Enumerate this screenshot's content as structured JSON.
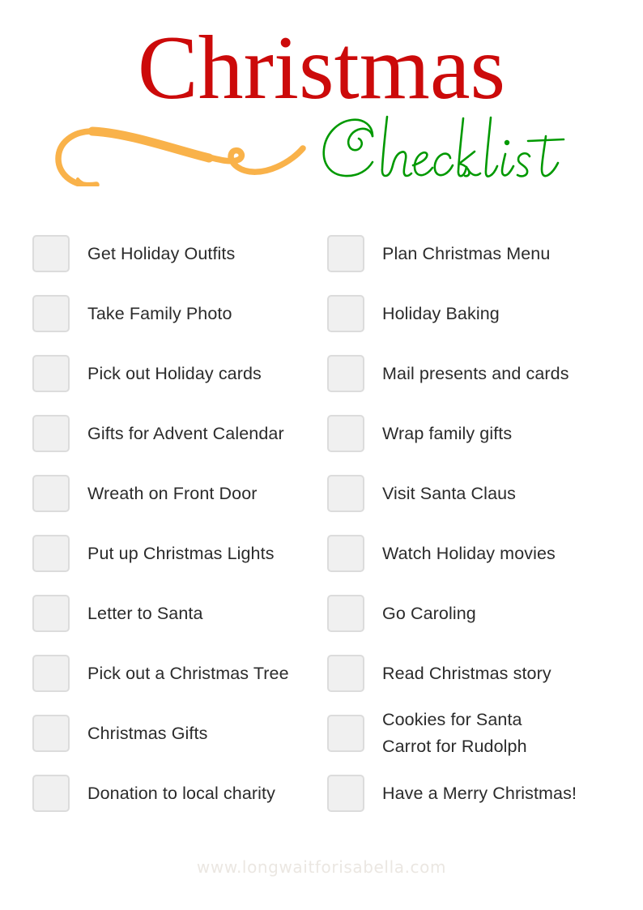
{
  "header": {
    "title_main": "Christmas",
    "title_script": "Checklist",
    "flourish_name": "orange-swash-flourish",
    "colors": {
      "title_red": "#CC0A0A",
      "script_green": "#009900",
      "flourish_orange": "#F9B24A"
    }
  },
  "checklist": {
    "checkbox_state": "unchecked",
    "columns": [
      {
        "name": "left-column",
        "items": [
          {
            "label": "Get Holiday Outfits"
          },
          {
            "label": "Take Family Photo"
          },
          {
            "label": "Pick out Holiday cards"
          },
          {
            "label": "Gifts for Advent Calendar"
          },
          {
            "label": "Wreath on Front Door"
          },
          {
            "label": "Put up Christmas Lights"
          },
          {
            "label": "Letter to Santa"
          },
          {
            "label": "Pick out a Christmas Tree"
          },
          {
            "label": "Christmas Gifts"
          },
          {
            "label": "Donation to local charity"
          }
        ]
      },
      {
        "name": "right-column",
        "items": [
          {
            "label": "Plan Christmas Menu"
          },
          {
            "label": "Holiday Baking"
          },
          {
            "label": "Mail presents and cards"
          },
          {
            "label": "Wrap family gifts"
          },
          {
            "label": "Visit Santa Claus"
          },
          {
            "label": "Watch Holiday movies"
          },
          {
            "label": "Go Caroling"
          },
          {
            "label": "Read Christmas story"
          },
          {
            "label": "Cookies for Santa\nCarrot for Rudolph"
          },
          {
            "label": "Have a Merry Christmas!"
          }
        ]
      }
    ]
  },
  "footer": {
    "watermark": "www.longwaitforisabella.com"
  }
}
